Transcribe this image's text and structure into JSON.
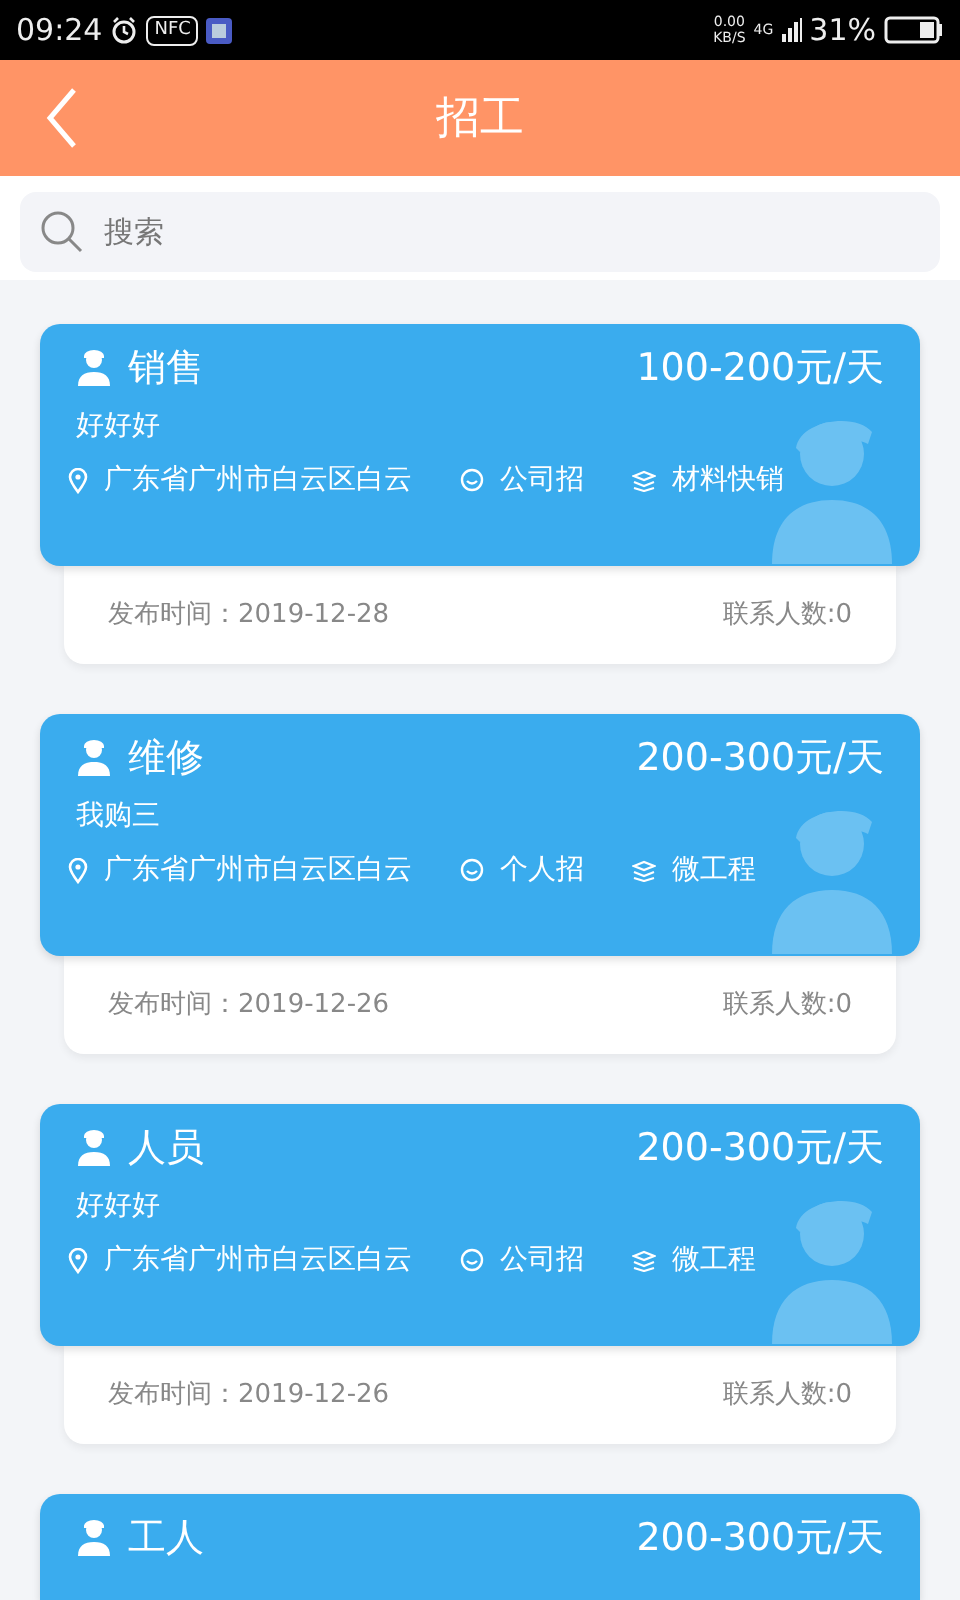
{
  "status_bar": {
    "time": "09:24",
    "nfc": "NFC",
    "speed_value": "0.00",
    "speed_unit": "KB/S",
    "network": "4G",
    "battery": "31%"
  },
  "header": {
    "title": "招工"
  },
  "search": {
    "placeholder": "搜索"
  },
  "jobs": [
    {
      "title": "销售",
      "salary": "100-200元/天",
      "description": "好好好",
      "location": "广东省广州市白云区白云",
      "recruiter": "公司招",
      "category": "材料快销",
      "posted": "发布时间：2019-12-28",
      "contacts": "联系人数:0"
    },
    {
      "title": "维修",
      "salary": "200-300元/天",
      "description": "我购三",
      "location": "广东省广州市白云区白云",
      "recruiter": "个人招",
      "category": "微工程",
      "posted": "发布时间：2019-12-26",
      "contacts": "联系人数:0"
    },
    {
      "title": "人员",
      "salary": "200-300元/天",
      "description": "好好好",
      "location": "广东省广州市白云区白云",
      "recruiter": "公司招",
      "category": "微工程",
      "posted": "发布时间：2019-12-26",
      "contacts": "联系人数:0"
    },
    {
      "title": "工人",
      "salary": "200-300元/天"
    }
  ]
}
